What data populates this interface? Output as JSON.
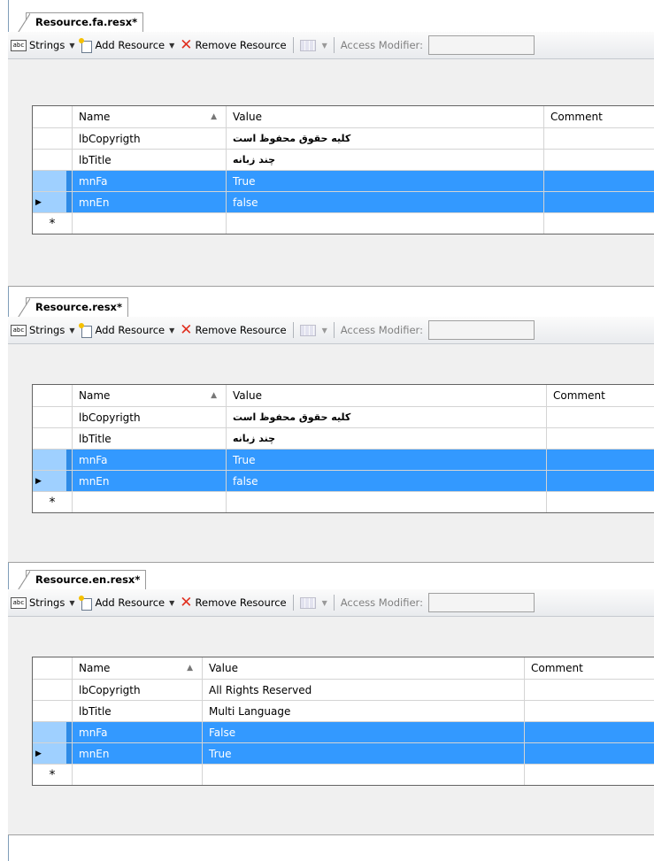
{
  "toolbar": {
    "strings_label": "Strings",
    "add_resource_label": "Add Resource",
    "remove_resource_label": "Remove Resource",
    "access_modifier_label": "Access Modifier:"
  },
  "columns": {
    "name": "Name",
    "value": "Value",
    "comment": "Comment"
  },
  "new_row_marker": "*",
  "panels": [
    {
      "tab_title": "Resource.fa.resx*",
      "rows": [
        {
          "name": "lbCopyrigth",
          "value": "کلیه حقوق محفوظ است",
          "comment": ""
        },
        {
          "name": "lbTitle",
          "value": "چند زبانه",
          "comment": ""
        },
        {
          "name": "mnFa",
          "value": "True",
          "comment": ""
        },
        {
          "name": "mnEn",
          "value": "false",
          "comment": ""
        }
      ]
    },
    {
      "tab_title": "Resource.resx*",
      "rows": [
        {
          "name": "lbCopyrigth",
          "value": "کلیه حقوق محفوظ است",
          "comment": ""
        },
        {
          "name": "lbTitle",
          "value": "چند زبانه",
          "comment": ""
        },
        {
          "name": "mnFa",
          "value": "True",
          "comment": ""
        },
        {
          "name": "mnEn",
          "value": "false",
          "comment": ""
        }
      ]
    },
    {
      "tab_title": "Resource.en.resx*",
      "rows": [
        {
          "name": "lbCopyrigth",
          "value": "All Rights Reserved",
          "comment": ""
        },
        {
          "name": "lbTitle",
          "value": "Multi Language",
          "comment": ""
        },
        {
          "name": "mnFa",
          "value": "False",
          "comment": ""
        },
        {
          "name": "mnEn",
          "value": "True",
          "comment": ""
        }
      ]
    }
  ],
  "colors": {
    "selection": "#3399ff",
    "border": "#646464"
  }
}
